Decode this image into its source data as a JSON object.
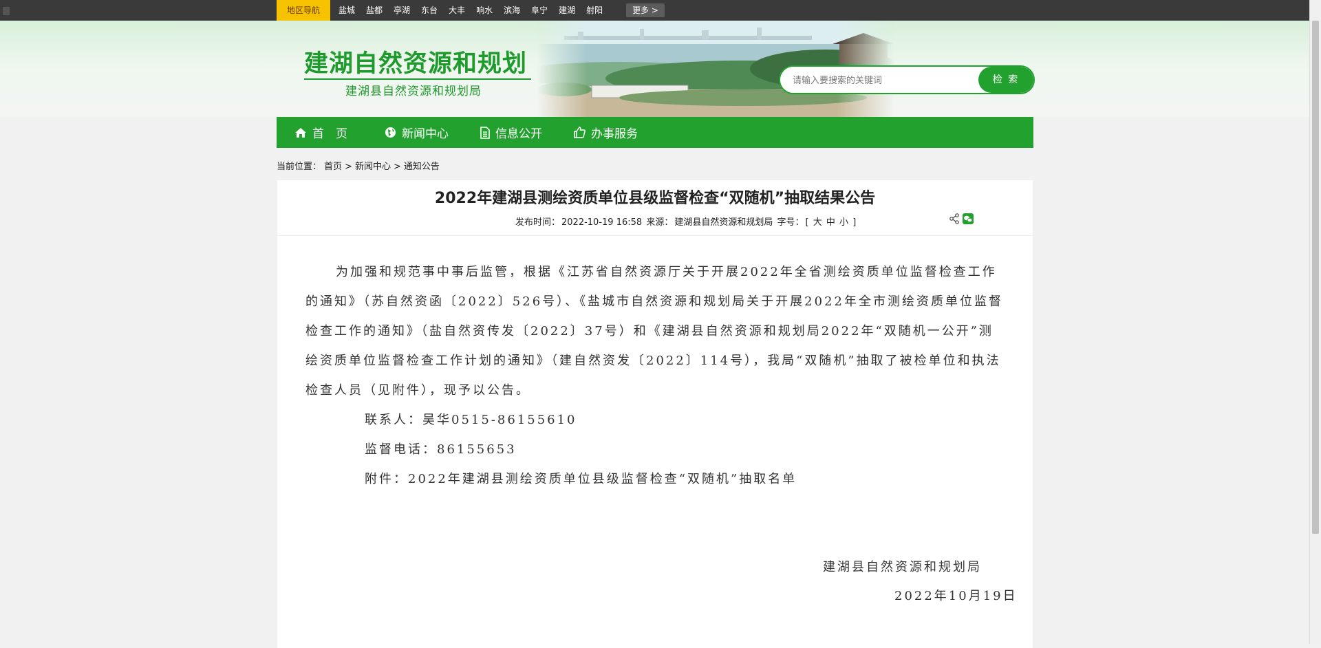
{
  "topbar": {
    "region_tag": "地区导航",
    "regions": [
      "盐城",
      "盐都",
      "亭湖",
      "东台",
      "大丰",
      "响水",
      "滨海",
      "阜宁",
      "建湖",
      "射阳"
    ],
    "more": "更多 >"
  },
  "header": {
    "site_title": "建湖自然资源和规划",
    "site_subtitle": "建湖县自然资源和规划局",
    "search_placeholder": "请输入要搜索的关键词",
    "search_button": "检 索"
  },
  "nav": [
    {
      "label": "首　页",
      "icon": "home-icon"
    },
    {
      "label": "新闻中心",
      "icon": "globe-icon"
    },
    {
      "label": "信息公开",
      "icon": "document-icon"
    },
    {
      "label": "办事服务",
      "icon": "thumbs-up-icon"
    }
  ],
  "breadcrumb": {
    "label": "当前位置：",
    "home": "首页",
    "sep1": ">",
    "news": "新闻中心",
    "sep2": ">",
    "notice": "通知公告"
  },
  "article": {
    "title": "2022年建湖县测绘资质单位县级监督检查“双随机”抽取结果公告",
    "meta_time_label": "发布时间：",
    "meta_time": "2022-10-19 16:58",
    "meta_source_label": "来源：",
    "meta_source": "建湖县自然资源和规划局",
    "meta_size_label": "字号：",
    "meta_size_open": "[",
    "size_large": "大",
    "size_medium": "中",
    "size_small": "小",
    "meta_size_close": "]",
    "paragraph": "为加强和规范事中事后监管，根据《江苏省自然资源厅关于开展2022年全省测绘资质单位监督检查工作的通知》（苏自然资函〔2022〕526号）、《盐城市自然资源和规划局关于开展2022年全市测绘资质单位监督检查工作的通知》（盐自然资传发〔2022〕37号）和《建湖县自然资源和规划局2022年“双随机一公开”测绘资质单位监督检查工作计划的通知》（建自然资发〔2022〕114号），我局“双随机”抽取了被检单位和执法检查人员（见附件），现予以公告。",
    "contact": "联系人：吴华0515-86155610",
    "phone": "监督电话：86155653",
    "attachment": "附件：2022年建湖县测绘资质单位县级监督检查“双随机”抽取名单",
    "sign_org": "建湖县自然资源和规划局",
    "sign_date": "2022年10月19日"
  }
}
